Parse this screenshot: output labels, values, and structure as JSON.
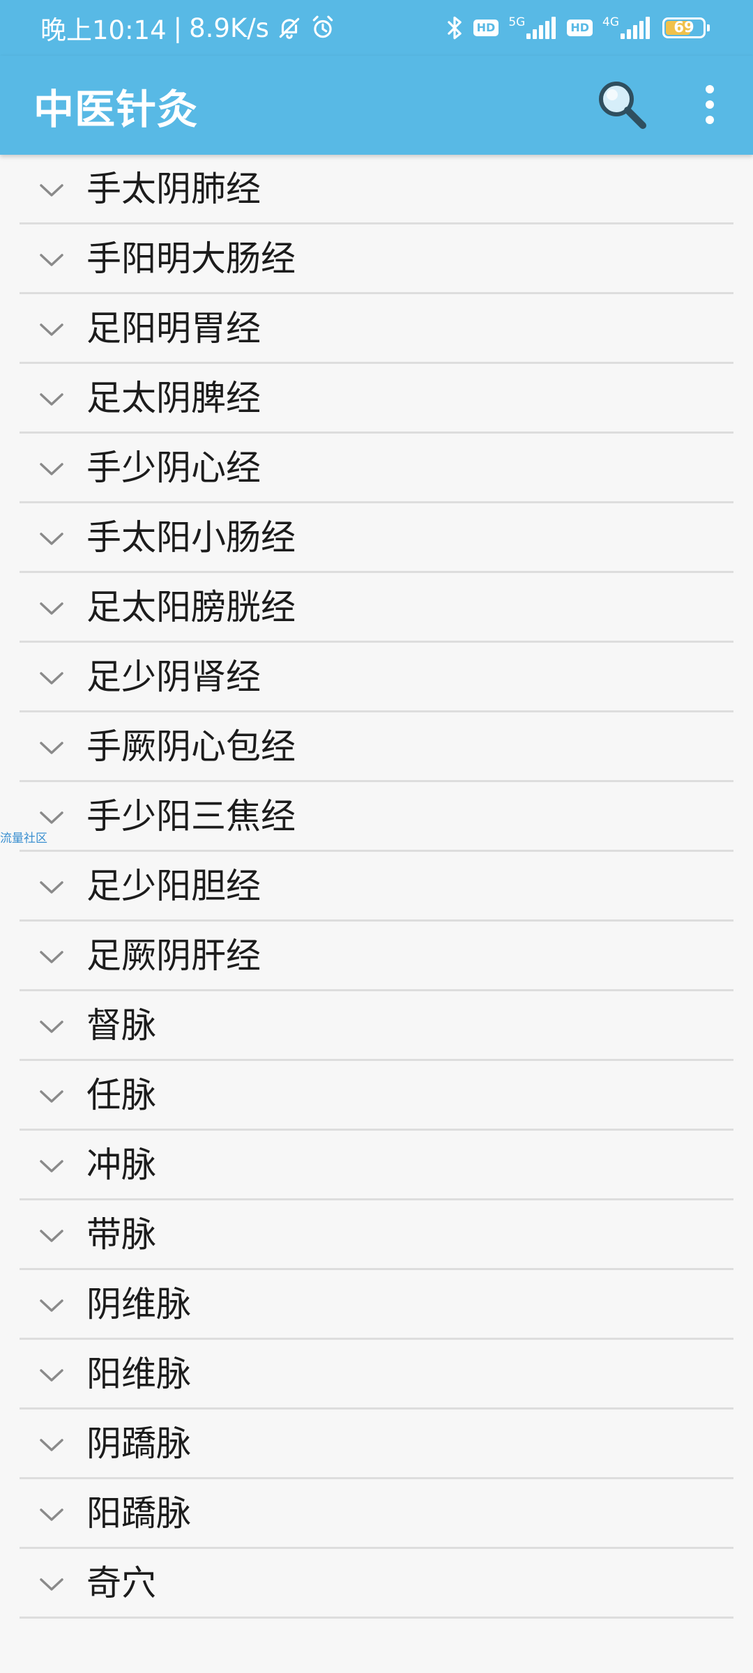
{
  "status_bar": {
    "time": "晚上10:14",
    "separator": "|",
    "net_speed": "8.9K/s",
    "icons": [
      "bell-off-icon",
      "alarm-icon",
      "bluetooth-icon",
      "hd-badge",
      "5g-signal-icon",
      "hd-badge",
      "4g-signal-icon",
      "battery-icon"
    ],
    "hd_label": "HD",
    "net1_label": "5G",
    "net2_label": "4G",
    "battery_level": "69",
    "battery_fraction": 0.69
  },
  "app_bar": {
    "title": "中医针灸",
    "actions": [
      "search-icon",
      "more-vert-icon"
    ],
    "color": "#58b9e5"
  },
  "meridian_list": {
    "items": [
      {
        "label": "手太阴肺经"
      },
      {
        "label": "手阳明大肠经"
      },
      {
        "label": "足阳明胃经"
      },
      {
        "label": "足太阴脾经"
      },
      {
        "label": "手少阴心经"
      },
      {
        "label": "手太阳小肠经"
      },
      {
        "label": "足太阳膀胱经"
      },
      {
        "label": "足少阴肾经"
      },
      {
        "label": "手厥阴心包经"
      },
      {
        "label": "手少阳三焦经"
      },
      {
        "label": "足少阳胆经"
      },
      {
        "label": "足厥阴肝经"
      },
      {
        "label": "督脉"
      },
      {
        "label": "任脉"
      },
      {
        "label": "冲脉"
      },
      {
        "label": "带脉"
      },
      {
        "label": "阴维脉"
      },
      {
        "label": "阳维脉"
      },
      {
        "label": "阴蹻脉"
      },
      {
        "label": "阳蹻脉"
      },
      {
        "label": "奇穴"
      }
    ],
    "expand_icon": "chevron-down-icon"
  },
  "overlay": {
    "watermark_text": "流量社区"
  }
}
